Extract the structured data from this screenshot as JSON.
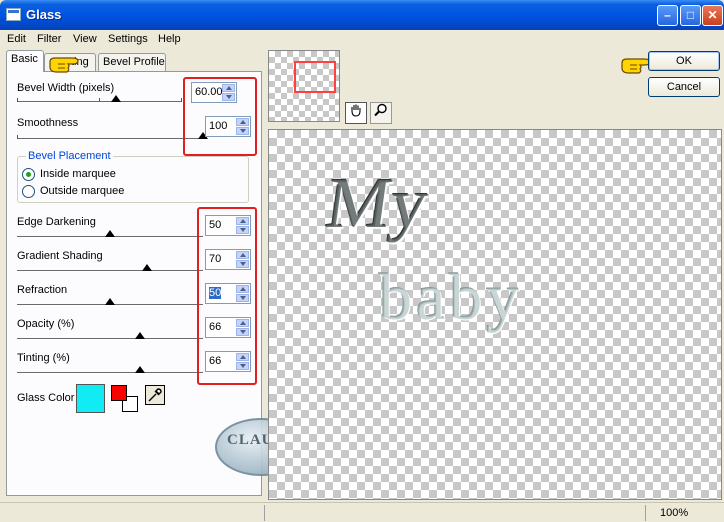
{
  "window": {
    "title": "Glass"
  },
  "menu": [
    "Edit",
    "Filter",
    "View",
    "Settings",
    "Help"
  ],
  "tabs": {
    "basic": "Basic",
    "lighting_fragment": "ting",
    "bevel_profile": "Bevel Profile"
  },
  "basic": {
    "bevel_width": {
      "label": "Bevel Width (pixels)",
      "value": "60.00",
      "level": 0.6
    },
    "smoothness": {
      "label": "Smoothness",
      "value": "100",
      "level": 1.0
    },
    "bevel_placement": {
      "legend": "Bevel Placement",
      "inside": "Inside marquee",
      "outside": "Outside marquee",
      "selected": "inside"
    },
    "edge_darkening": {
      "label": "Edge Darkening",
      "value": "50",
      "level": 0.5
    },
    "gradient_shading": {
      "label": "Gradient Shading",
      "value": "70",
      "level": 0.7
    },
    "refraction": {
      "label": "Refraction",
      "value": "50",
      "level": 0.5
    },
    "opacity": {
      "label": "Opacity (%)",
      "value": "66",
      "level": 0.66
    },
    "tinting": {
      "label": "Tinting (%)",
      "value": "66",
      "level": 0.66
    },
    "glass_color": {
      "label": "Glass Color",
      "swatch": "#11ecf4",
      "fg": "#ff0000",
      "bg": "#ffffff"
    }
  },
  "watermark": "CLAUDIA",
  "preview": {
    "line1": "My",
    "line2": "baby"
  },
  "buttons": {
    "ok": "OK",
    "cancel": "Cancel"
  },
  "status": {
    "zoom": "100%"
  },
  "colors": {
    "highlight": "#e02020",
    "accent_blue": "#0054e3"
  }
}
